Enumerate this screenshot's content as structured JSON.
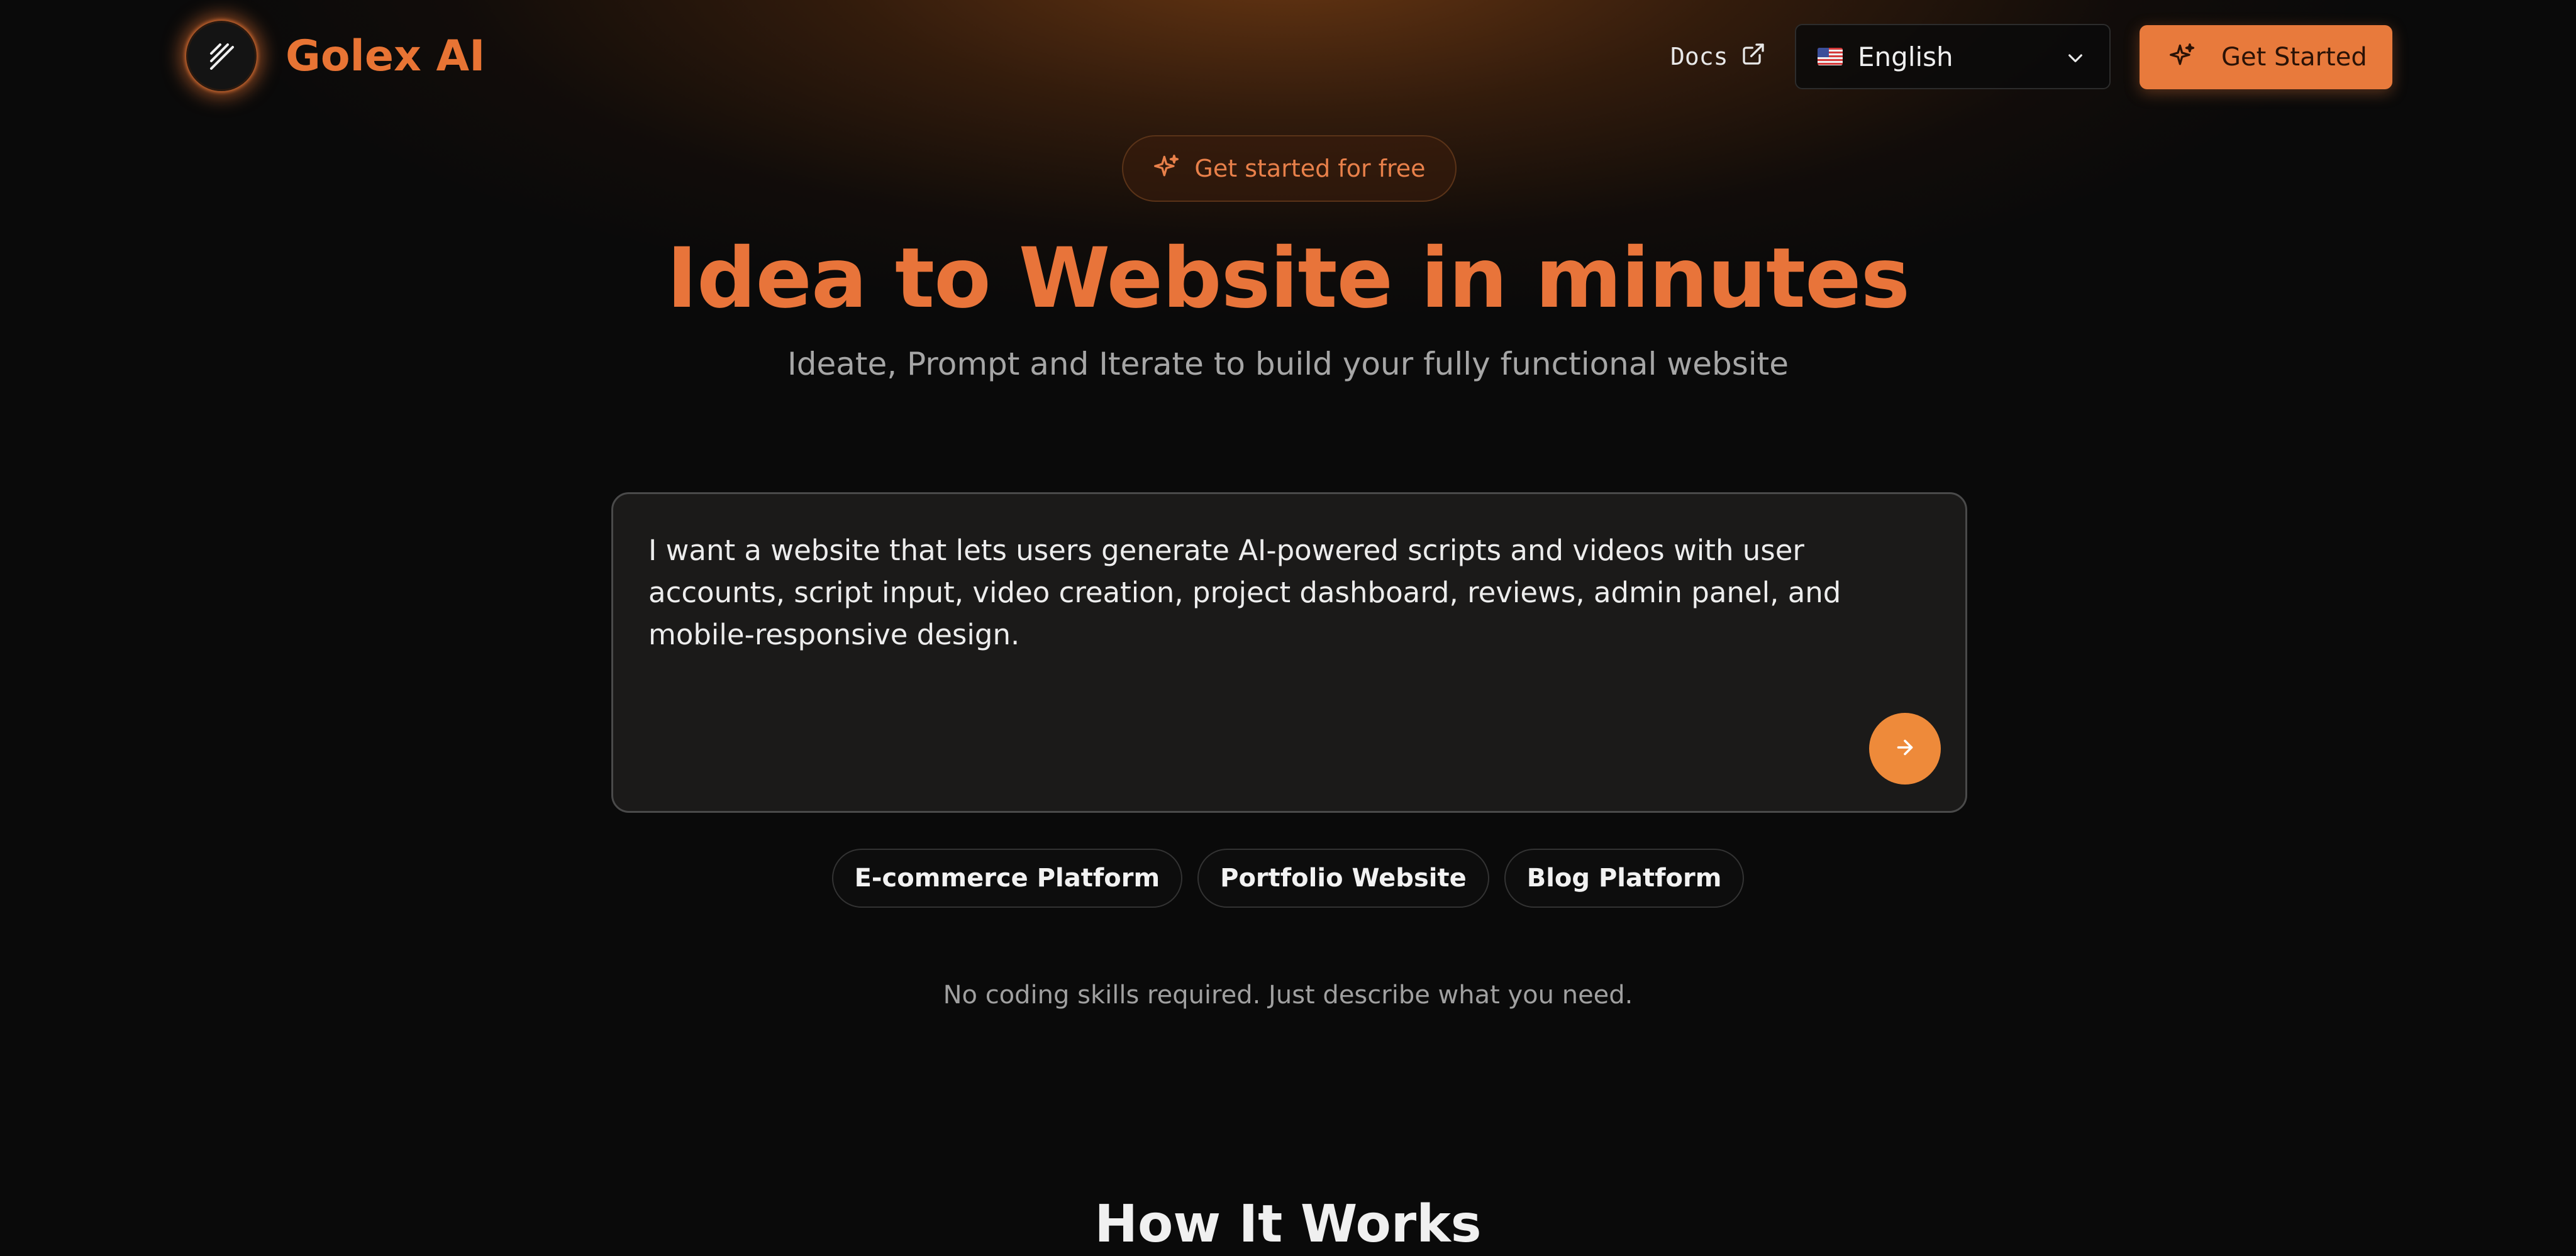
{
  "header": {
    "brand": "Golex AI",
    "docs_label": "Docs",
    "language": "English",
    "get_started_label": "Get Started"
  },
  "hero": {
    "pill_label": "Get started for free",
    "headline": "Idea to Website in minutes",
    "subheadline": "Ideate, Prompt and Iterate to build your fully functional website"
  },
  "prompt": {
    "value": "I want a website that lets users generate AI-powered scripts and videos with user accounts, script input, video creation, project dashboard, reviews, admin panel, and mobile-responsive design."
  },
  "suggestions": [
    "E-commerce Platform",
    "Portfolio Website",
    "Blog Platform"
  ],
  "note": "No coding skills required. Just describe what you need.",
  "section_heading": "How It Works",
  "icons": {
    "logo": "slashes-logo-icon",
    "docs": "external-link-icon",
    "language_flag": "us-flag-icon",
    "language_dropdown": "chevron-down-icon",
    "get_started": "sparkle-icon",
    "pill": "sparkle-icon",
    "send": "arrow-right-icon"
  },
  "colors": {
    "accent": "#e87434",
    "button": "#e87a3c",
    "send_button": "#ee8a3a",
    "background": "#0a0a0a",
    "prompt_background": "#1b1a19"
  }
}
